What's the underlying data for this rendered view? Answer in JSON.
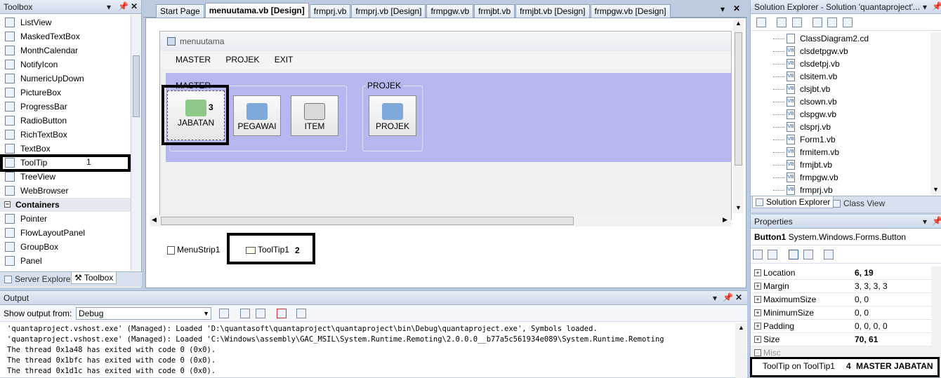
{
  "toolbox": {
    "title": "Toolbox",
    "items": [
      {
        "label": "ListView",
        "icon": "listview-icon"
      },
      {
        "label": "MaskedTextBox",
        "icon": "maskedtextbox-icon"
      },
      {
        "label": "MonthCalendar",
        "icon": "monthcalendar-icon"
      },
      {
        "label": "NotifyIcon",
        "icon": "notifyicon-icon"
      },
      {
        "label": "NumericUpDown",
        "icon": "numericupdown-icon"
      },
      {
        "label": "PictureBox",
        "icon": "picturebox-icon"
      },
      {
        "label": "ProgressBar",
        "icon": "progressbar-icon"
      },
      {
        "label": "RadioButton",
        "icon": "radiobutton-icon"
      },
      {
        "label": "RichTextBox",
        "icon": "richtextbox-icon"
      },
      {
        "label": "TextBox",
        "icon": "textbox-icon"
      },
      {
        "label": "ToolTip",
        "icon": "tooltip-icon"
      },
      {
        "label": "TreeView",
        "icon": "treeview-icon"
      },
      {
        "label": "WebBrowser",
        "icon": "webbrowser-icon"
      }
    ],
    "group": "Containers",
    "group_items": [
      {
        "label": "Pointer",
        "icon": "pointer-icon"
      },
      {
        "label": "FlowLayoutPanel",
        "icon": "flowlayoutpanel-icon"
      },
      {
        "label": "GroupBox",
        "icon": "groupbox-icon"
      },
      {
        "label": "Panel",
        "icon": "panel-icon"
      }
    ],
    "bottom_tabs": [
      "Server Explorer",
      "Toolbox"
    ],
    "annotation_1": "1"
  },
  "editor": {
    "tabs": [
      "Start Page",
      "menuutama.vb [Design]",
      "frmprj.vb",
      "frmprj.vb [Design]",
      "frmpgw.vb",
      "frmjbt.vb",
      "frmjbt.vb [Design]",
      "frmpgw.vb [Design]"
    ],
    "active_tab": 1,
    "form_title": "menuutama",
    "menu": [
      "MASTER",
      "PROJEK",
      "EXIT"
    ],
    "group_master": "MASTER",
    "group_projek": "PROJEK",
    "buttons": {
      "jabatan": "JABATAN",
      "pegawai": "PEGAWAI",
      "item": "ITEM",
      "projek": "PROJEK"
    },
    "annotation_3": "3",
    "tray": {
      "menustrip": "MenuStrip1",
      "tooltip": "ToolTip1"
    },
    "annotation_2": "2",
    "colors": {
      "form_panel": "#b7b7f0",
      "highlight": "#000000"
    }
  },
  "solution_explorer": {
    "title": "Solution Explorer - Solution 'quantaproject'...",
    "files": [
      "ClassDiagram2.cd",
      "clsdetpgw.vb",
      "clsdetpj.vb",
      "clsitem.vb",
      "clsjbt.vb",
      "clsown.vb",
      "clspgw.vb",
      "clsprj.vb",
      "Form1.vb",
      "frmitem.vb",
      "frmjbt.vb",
      "frmpgw.vb",
      "frmprj.vb"
    ],
    "tabs": [
      "Solution Explorer",
      "Class View"
    ]
  },
  "properties": {
    "title": "Properties",
    "object_name": "Button1",
    "object_type": "System.Windows.Forms.Button",
    "rows": [
      {
        "name": "Location",
        "value": "6, 19",
        "bold": true
      },
      {
        "name": "Margin",
        "value": "3, 3, 3, 3",
        "bold": false
      },
      {
        "name": "MaximumSize",
        "value": "0, 0",
        "bold": false
      },
      {
        "name": "MinimumSize",
        "value": "0, 0",
        "bold": false
      },
      {
        "name": "Padding",
        "value": "0, 0, 0, 0",
        "bold": false
      },
      {
        "name": "Size",
        "value": "70, 61",
        "bold": true
      }
    ],
    "category": "Misc",
    "tooltip_row": {
      "name": "ToolTip on ToolTip1",
      "annotation": "4",
      "value": "MASTER JABATAN"
    }
  },
  "output": {
    "title": "Output",
    "show_from_label": "Show output from:",
    "show_from_value": "Debug",
    "lines": [
      "'quantaproject.vshost.exe' (Managed): Loaded 'D:\\quantasoft\\quantaproject\\quantaproject\\bin\\Debug\\quantaproject.exe', Symbols loaded.",
      "'quantaproject.vshost.exe' (Managed): Loaded 'C:\\Windows\\assembly\\GAC_MSIL\\System.Runtime.Remoting\\2.0.0.0__b77a5c561934e089\\System.Runtime.Remoting",
      "The thread 0x1a48 has exited with code 0 (0x0).",
      "The thread 0x1bfc has exited with code 0 (0x0).",
      "The thread 0x1d1c has exited with code 0 (0x0)."
    ]
  }
}
